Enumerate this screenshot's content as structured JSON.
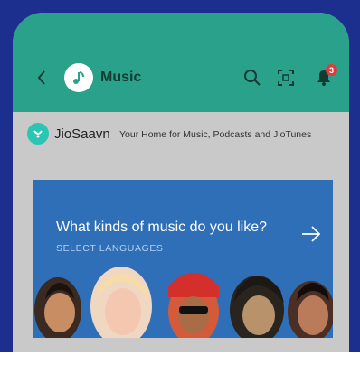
{
  "header": {
    "title": "Music",
    "notification_count": "3",
    "icons": {
      "back": "back-arrow-icon",
      "app": "music-note-icon",
      "search": "search-icon",
      "scan": "scan-icon",
      "notifications": "bell-icon"
    }
  },
  "jiosaavn": {
    "name": "JioSaavn",
    "tagline": "Your Home for Music, Podcasts and JioTunes"
  },
  "banner": {
    "title": "What kinds of music do you like?",
    "subtitle": "SELECT LANGUAGES"
  },
  "colors": {
    "frame": "#1c2f8e",
    "header": "#2aa28b",
    "banner": "#2e6fb8",
    "badge": "#e23a3a"
  }
}
